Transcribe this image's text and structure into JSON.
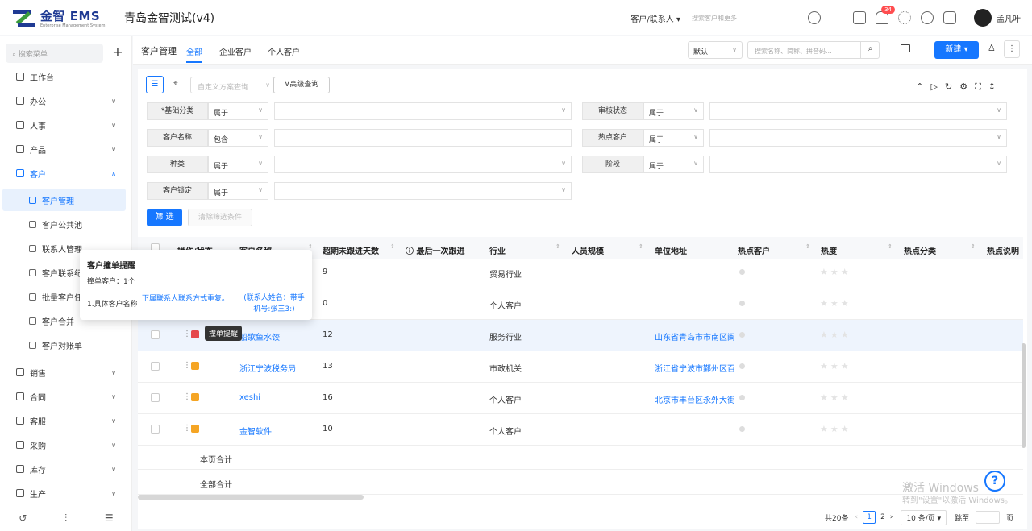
{
  "app": {
    "brand": "金智 EMS",
    "brand_sub": "Enterprise Management System",
    "title": "青岛金智测试(v4)"
  },
  "header": {
    "scope": "客户/联系人 ▾",
    "search_placeholder": "搜索客户和更多",
    "notify_count": "34",
    "username": "孟凡叶",
    "accent": "#1677ff"
  },
  "sidebar": {
    "search_placeholder": "搜索菜单",
    "add_label": "+",
    "top_items": [
      {
        "label": "工作台",
        "icon": "dashboard-icon"
      },
      {
        "label": "办公",
        "icon": "office-icon"
      },
      {
        "label": "人事",
        "icon": "people-icon"
      },
      {
        "label": "产品",
        "icon": "product-icon"
      },
      {
        "label": "客户",
        "icon": "customer-icon"
      }
    ],
    "sub_items": [
      {
        "label": "客户管理"
      },
      {
        "label": "客户公共池"
      },
      {
        "label": "联系人管理"
      },
      {
        "label": "客户联系纪"
      },
      {
        "label": "批量客户任"
      },
      {
        "label": "客户合并"
      },
      {
        "label": "客户对账单"
      }
    ],
    "bottom_items": [
      {
        "label": "销售"
      },
      {
        "label": "合同"
      },
      {
        "label": "客服"
      },
      {
        "label": "采购"
      },
      {
        "label": "库存"
      },
      {
        "label": "生产"
      }
    ]
  },
  "main": {
    "title": "客户管理",
    "tabs": [
      "全部",
      "企业客户",
      "个人客户"
    ],
    "sort_value": "默认",
    "keyword_placeholder": "搜索名称、简称、拼音码...",
    "new_label": "新建 ▾"
  },
  "filter": {
    "scheme_placeholder": "自定义方案查询",
    "advanced_label": "高级查询",
    "rows": [
      {
        "label": "*基础分类",
        "op": "属于"
      },
      {
        "label": "审核状态",
        "op": "属于"
      },
      {
        "label": "客户名称",
        "op": "包含"
      },
      {
        "label": "热点客户",
        "op": "属于"
      },
      {
        "label": "种类",
        "op": "属于"
      },
      {
        "label": "阶段",
        "op": "属于"
      },
      {
        "label": "客户锁定",
        "op": "属于"
      }
    ],
    "filter_btn": "筛 选",
    "clear_btn": "清除筛选条件"
  },
  "table": {
    "headers": [
      "操作/状态",
      "客户名称",
      "超期未跟进天数",
      "最后一次跟进",
      "行业",
      "人员规模",
      "单位地址",
      "热点客户",
      "热度",
      "热点分类",
      "热点说明"
    ],
    "rows": [
      {
        "name": "",
        "days": "9",
        "industry": "贸易行业",
        "address": "",
        "tag": "orange"
      },
      {
        "name": "",
        "days": "0",
        "industry": "个人客户",
        "address": "",
        "tag": "orange"
      },
      {
        "name": "船歌鱼水饺",
        "days": "12",
        "industry": "服务行业",
        "address": "山东省青岛市市南区闽",
        "tag": "red"
      },
      {
        "name": "浙江宁波税务局",
        "days": "13",
        "industry": "市政机关",
        "address": "浙江省宁波市鄞州区百",
        "tag": "orange"
      },
      {
        "name": "xeshi",
        "days": "16",
        "industry": "个人客户",
        "address": "北京市丰台区永外大街",
        "tag": "orange"
      },
      {
        "name": "金智软件",
        "days": "10",
        "industry": "个人客户",
        "address": "",
        "tag": "orange"
      }
    ],
    "stars": "★★★",
    "page_total": "本页合计",
    "all_total": "全部合计"
  },
  "pager": {
    "total": "共20条",
    "page1": "1",
    "page2": "2",
    "size": "10 条/页 ▾",
    "goto": "跳至",
    "page_unit": "页"
  },
  "popup": {
    "title": "客户撞单提醒",
    "count": "撞单客户：1个",
    "item": "1.具体客户名称",
    "dup": "下属联系人联系方式重复。",
    "contact": "(联系人姓名：带手机号:张三3:)",
    "hover_tip": "撞单提醒"
  },
  "watermark": {
    "line1": "激活 Windows",
    "line2": "转到\"设置\"以激活 Windows。"
  },
  "help": "?"
}
